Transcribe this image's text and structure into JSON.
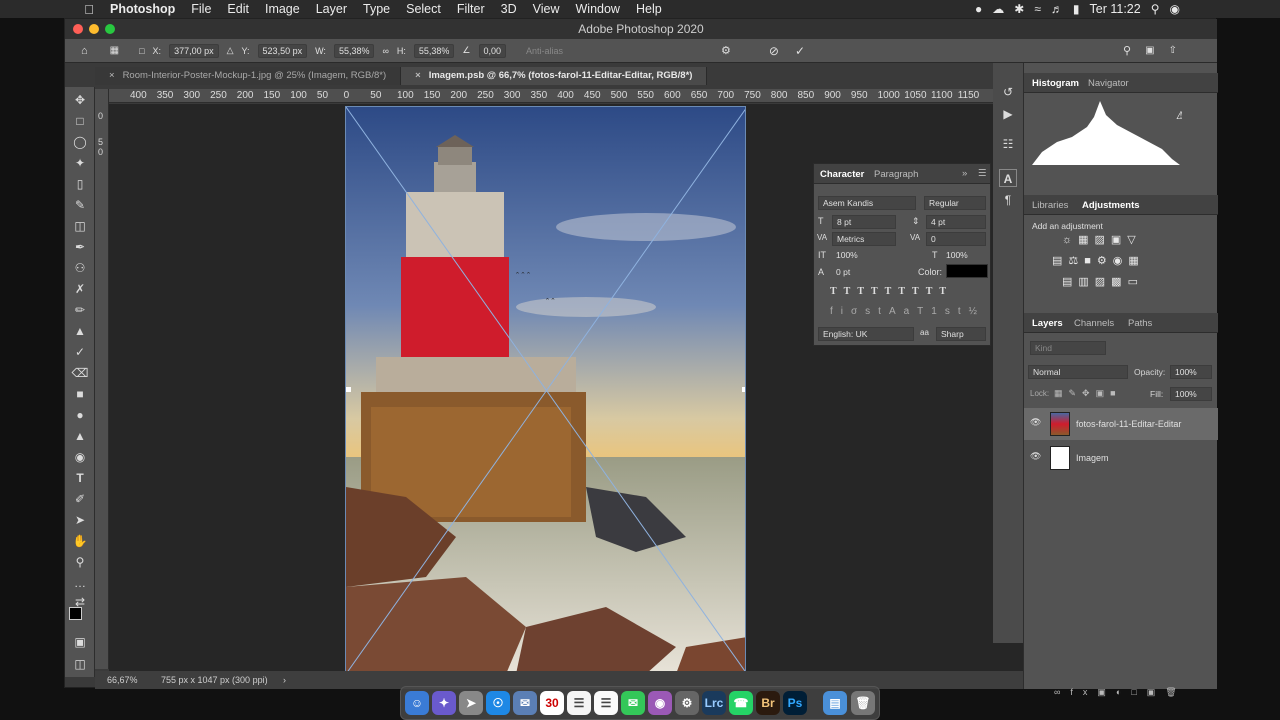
{
  "menubar": {
    "app": "Photoshop",
    "items": [
      "File",
      "Edit",
      "Image",
      "Layer",
      "Type",
      "Select",
      "Filter",
      "3D",
      "View",
      "Window",
      "Help"
    ],
    "clock": "Ter 11:22"
  },
  "window": {
    "title": "Adobe Photoshop 2020"
  },
  "options_bar": {
    "x_label": "X:",
    "x_value": "377,00 px",
    "y_label": "Y:",
    "y_value": "523,50 px",
    "w_label": "W:",
    "w_value": "55,38%",
    "h_label": "H:",
    "h_value": "55,38%",
    "angle_value": "0,00",
    "antialias": "Anti-alias"
  },
  "tabs": [
    {
      "label": "Room-Interior-Poster-Mockup-1.jpg @ 25% (Imagem, RGB/8*)"
    },
    {
      "label": "Imagem.psb @ 66,7% (fotos-farol-11-Editar-Editar, RGB/8*)"
    }
  ],
  "ruler": {
    "h_ticks": [
      "400",
      "350",
      "300",
      "250",
      "200",
      "150",
      "100",
      "50",
      "0",
      "50",
      "100",
      "150",
      "200",
      "250",
      "300",
      "350",
      "400",
      "450",
      "500",
      "550",
      "600",
      "650",
      "700",
      "750",
      "800",
      "850",
      "900",
      "950",
      "1000",
      "1050",
      "1100",
      "1150"
    ]
  },
  "status": {
    "zoom": "66,67%",
    "doc_size": "755 px x 1047 px (300 ppi)"
  },
  "panels": {
    "histogram_tab": "Histogram",
    "navigator_tab": "Navigator",
    "libraries_tab": "Libraries",
    "adjustments_tab": "Adjustments",
    "add_adjustment": "Add an adjustment",
    "layers_tab": "Layers",
    "channels_tab": "Channels",
    "paths_tab": "Paths",
    "kind_placeholder": "Kind",
    "blend_mode": "Normal",
    "opacity_label": "Opacity:",
    "opacity_value": "100%",
    "lock_label": "Lock:",
    "fill_label": "Fill:",
    "fill_value": "100%",
    "layers": [
      {
        "name": "fotos-farol-11-Editar-Editar"
      },
      {
        "name": "Imagem"
      }
    ]
  },
  "character": {
    "tab": "Character",
    "paragraph_tab": "Paragraph",
    "font": "Asem Kandis",
    "style": "Regular",
    "size": "8 pt",
    "leading": "4 pt",
    "kerning": "Metrics",
    "tracking": "0",
    "vscale": "100%",
    "hscale": "100%",
    "baseline": "0 pt",
    "color_label": "Color:",
    "language": "English: UK",
    "antialias": "Sharp"
  },
  "colors": {
    "accent": "#6b8bb5",
    "panel": "#535353",
    "canvas_bg": "#262626"
  }
}
